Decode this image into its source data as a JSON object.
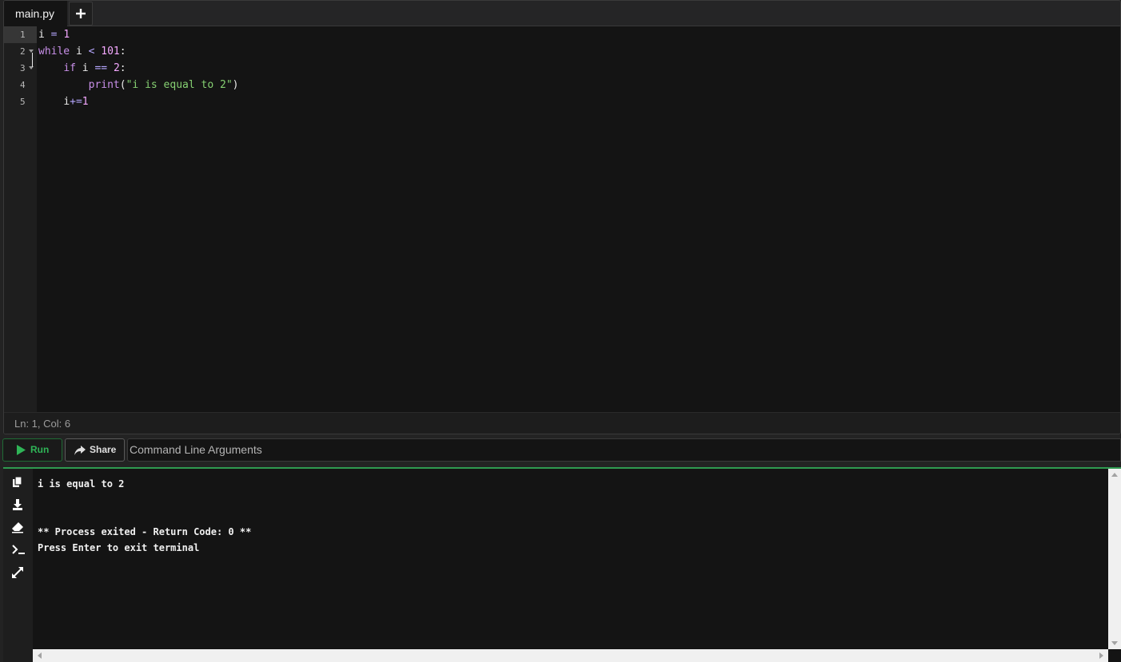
{
  "editor": {
    "tab": {
      "label": "main.py"
    },
    "add_tab_icon": "plus-icon",
    "line_numbers": [
      "1",
      "2",
      "3",
      "4",
      "5"
    ],
    "code": {
      "line1": {
        "var": "i",
        "op": " = ",
        "num": "1"
      },
      "line2": {
        "kw": "while",
        "var": " i ",
        "op": "<",
        "sp": " ",
        "num": "101",
        "colon": ":"
      },
      "line3": {
        "indent": "    ",
        "kw": "if",
        "var": " i ",
        "op": "==",
        "sp": " ",
        "num": "2",
        "colon": ":"
      },
      "line4": {
        "indent": "        ",
        "fn": "print",
        "paren_open": "(",
        "str": "\"i is equal to 2\"",
        "paren_close": ")"
      },
      "line5": {
        "indent": "    ",
        "var": "i",
        "op": "+=",
        "num": "1"
      }
    },
    "status": "Ln: 1,  Col: 6"
  },
  "toolbar": {
    "run_label": "Run",
    "share_label": "Share",
    "args_placeholder": "Command Line Arguments"
  },
  "terminal": {
    "side_icons": [
      "copy-icon",
      "download-icon",
      "eraser-icon",
      "terminal-icon",
      "expand-icon"
    ],
    "output": {
      "line1": "i is equal to 2",
      "line2": "** Process exited - Return Code: 0 **",
      "line3": "Press Enter to exit terminal"
    }
  },
  "colors": {
    "background": "#141414",
    "run_green": "#2fb457",
    "keyword": "#c990ea",
    "number": "#f4a8ff",
    "string": "#86d072"
  }
}
